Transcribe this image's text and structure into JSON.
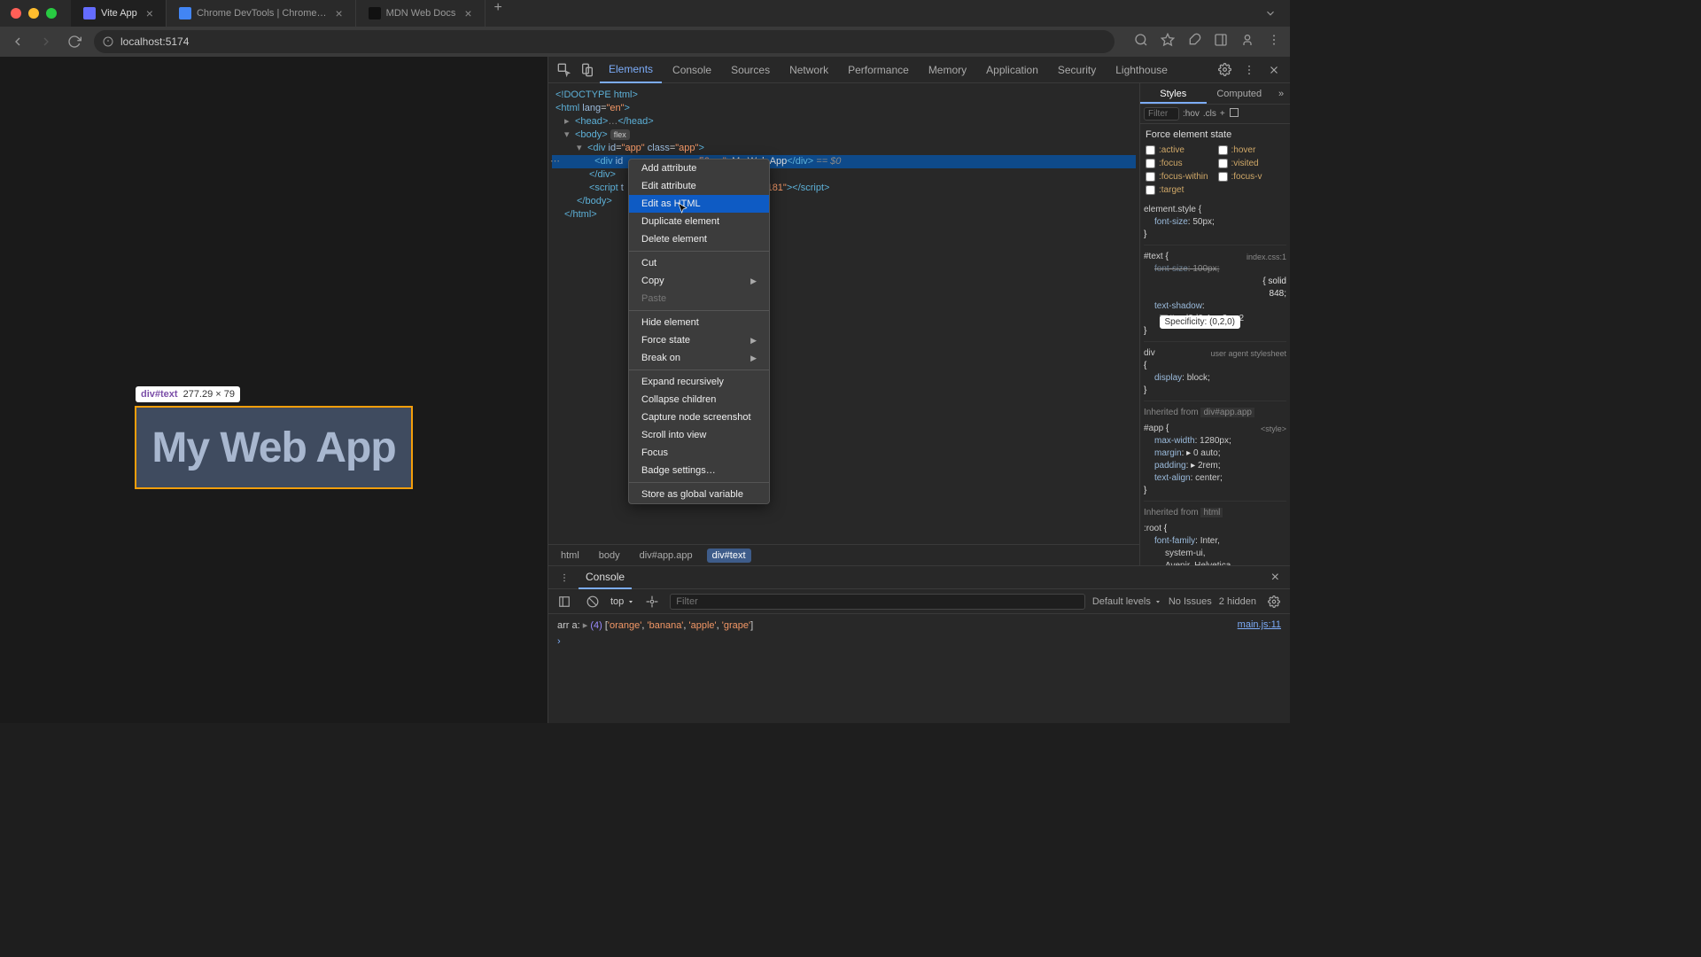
{
  "titlebar": {
    "tabs": [
      {
        "title": "Vite App",
        "active": true,
        "favicon_color": "#646cff"
      },
      {
        "title": "Chrome DevTools | Chrome…",
        "active": false,
        "favicon_color": "#4285f4"
      },
      {
        "title": "MDN Web Docs",
        "active": false,
        "favicon_color": "#111"
      }
    ]
  },
  "urlbar": {
    "url": "localhost:5174"
  },
  "viewport": {
    "tooltip_selector": "div#text",
    "tooltip_dims": "277.29 × 79",
    "highlighted_text": "My Web App"
  },
  "devtools": {
    "tabs": [
      "Elements",
      "Console",
      "Sources",
      "Network",
      "Performance",
      "Memory",
      "Application",
      "Security",
      "Lighthouse"
    ],
    "active_tab": "Elements",
    "dom": {
      "doctype": "<!DOCTYPE html>",
      "html_open": "<html lang=\"en\">",
      "head": "<head>…</head>",
      "body_open": "<body>",
      "body_badge": "flex",
      "app_open": "<div id=\"app\" class=\"app\">",
      "selected_prefix": "<div id",
      "selected_suffix_frag": "50px;\">",
      "selected_text": "My Web App",
      "selected_close": "</div>",
      "eq": " == $0",
      "div_close": "</div>",
      "script_frag_prefix": "<script t",
      "script_frag_suffix": "s?t=1710504969181\">",
      "script_close_tag": "</",
      "script_close_tag2": "script>",
      "body_close": "</body>",
      "html_close": "</html>"
    },
    "breadcrumbs": [
      "html",
      "body",
      "div#app.app",
      "div#text"
    ],
    "ctx_menu": {
      "items": [
        {
          "label": "Add attribute"
        },
        {
          "label": "Edit attribute"
        },
        {
          "label": "Edit as HTML",
          "highlighted": true
        },
        {
          "label": "Duplicate element"
        },
        {
          "label": "Delete element"
        },
        {
          "sep": true
        },
        {
          "label": "Cut"
        },
        {
          "label": "Copy",
          "submenu": true
        },
        {
          "label": "Paste",
          "disabled": true
        },
        {
          "sep": true
        },
        {
          "label": "Hide element"
        },
        {
          "label": "Force state",
          "submenu": true
        },
        {
          "label": "Break on",
          "submenu": true
        },
        {
          "sep": true
        },
        {
          "label": "Expand recursively"
        },
        {
          "label": "Collapse children"
        },
        {
          "label": "Capture node screenshot"
        },
        {
          "label": "Scroll into view"
        },
        {
          "label": "Focus"
        },
        {
          "label": "Badge settings…"
        },
        {
          "sep": true
        },
        {
          "label": "Store as global variable"
        }
      ]
    }
  },
  "styles": {
    "tabs": [
      "Styles",
      "Computed"
    ],
    "filter_placeholder": "Filter",
    "hov": ":hov",
    "cls": ".cls",
    "force_title": "Force element state",
    "force_states": [
      ":active",
      ":hover",
      ":focus",
      ":visited",
      ":focus-within",
      ":focus-v",
      ":target"
    ],
    "specificity_tip": "Specificity: (0,2,0)",
    "rules": {
      "element_style": {
        "sel": "element.style {",
        "lines": [
          "font-size: 50px;"
        ]
      },
      "text_rule": {
        "sel": "#text {",
        "src": "index.css:1",
        "lines": [
          "font-size: 100px;",
          "{ solid",
          "848;",
          "text-shadow:",
          "#acd3d0 4px 2px 2"
        ]
      },
      "div_rule": {
        "sel": "div",
        "src": "user agent stylesheet",
        "lines": [
          "display: block;"
        ]
      },
      "inherited_app": "Inherited from div#app.app",
      "app_rule": {
        "sel": "#app {",
        "src": "<style>",
        "lines": [
          "max-width: 1280px;",
          "margin: ▸ 0 auto;",
          "padding: ▸ 2rem;",
          "text-align: center;"
        ]
      },
      "inherited_html": "Inherited from html",
      "root_rule": {
        "sel": ":root {",
        "lines": [
          "font-family: Inter,",
          "system-ui,",
          "Avenir, Helvetica,"
        ]
      }
    }
  },
  "console": {
    "tab": "Console",
    "ctx": "top",
    "filter_placeholder": "Filter",
    "levels": "Default levels",
    "issues": "No Issues",
    "hidden": "2 hidden",
    "log_label": "arr a:",
    "log_count": "(4)",
    "log_items": [
      "'orange'",
      "'banana'",
      "'apple'",
      "'grape'"
    ],
    "log_src": "main.js:11"
  }
}
